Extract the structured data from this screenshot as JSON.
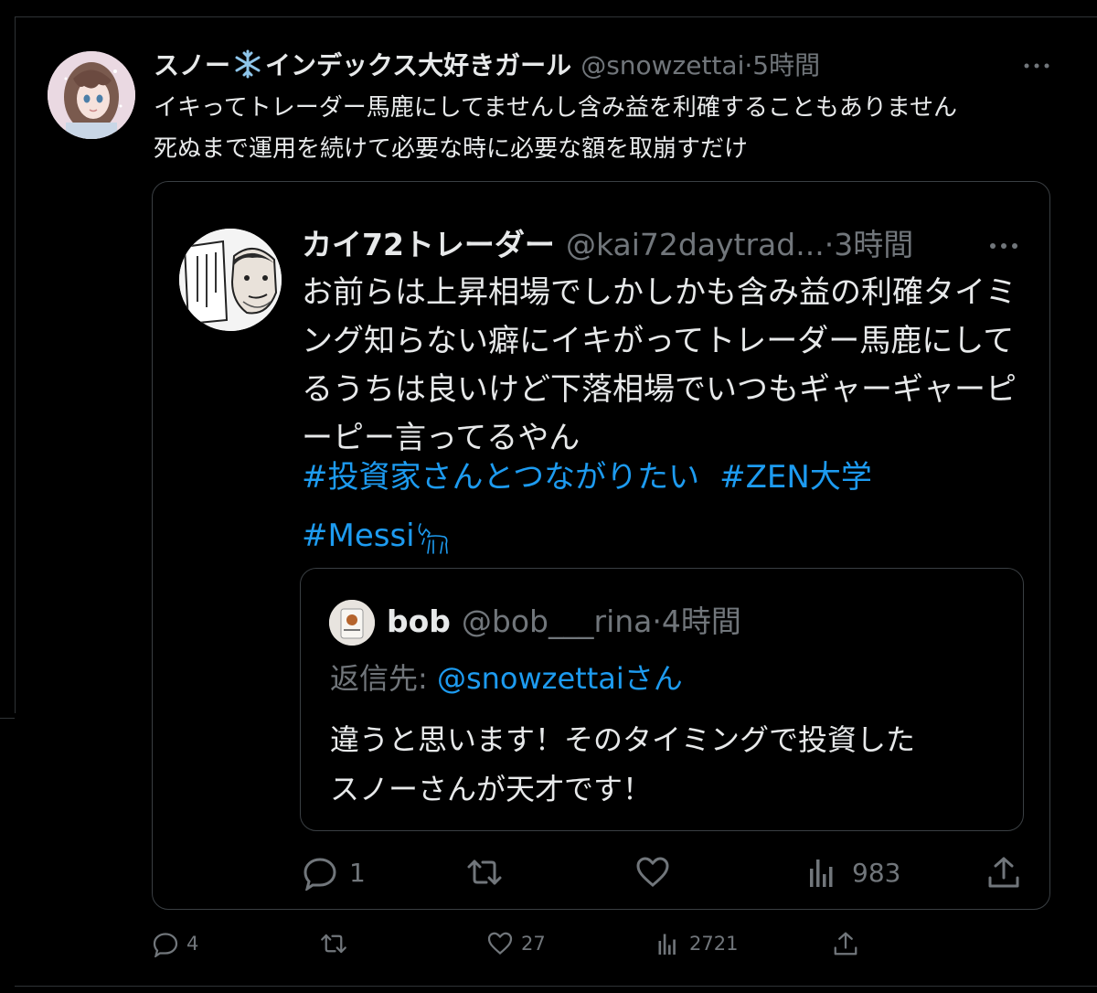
{
  "main_tweet": {
    "display_name_part1": "スノー",
    "display_name_part2": "インデックス大好きガール",
    "name_emoji": "snowflake-icon",
    "handle": "@snowzettai",
    "separator": "·",
    "time": "5時間",
    "text_line1": "イキってトレーダー馬鹿にしてませんし含み益を利確することもありません",
    "text_line2": "死ぬまで運用を続けて必要な時に必要な額を取崩すだけ",
    "actions": {
      "replies": "4",
      "retweets": "",
      "likes": "27",
      "views": "2721"
    }
  },
  "quoted_tweet": {
    "display_name": "カイ72トレーダー",
    "handle": "@kai72daytrad...",
    "separator": "·",
    "time": "3時間",
    "text": "お前らは上昇相場でしかしかも含み益の利確タイミング知らない癖にイキがってトレーダー馬鹿にしてるうちは良いけど下落相場でいつもギャーギャーピーピー言ってるやん",
    "hashtags": [
      "#投資家さんとつながりたい",
      "#ZEN大学",
      "#Messi"
    ],
    "hashtag_emoji": "goat-icon",
    "actions": {
      "replies": "1",
      "retweets": "",
      "likes": "",
      "views": "983"
    }
  },
  "nested_tweet": {
    "display_name": "bob",
    "handle": "@bob___rina",
    "separator": "·",
    "time": "4時間",
    "reply_prefix": "返信先: ",
    "reply_mention": "@snowzettai",
    "reply_suffix": "さん",
    "text_line1": "違うと思います！そのタイミングで投資した",
    "text_line2": "スノーさんが天才です！"
  },
  "colors": {
    "background": "#000000",
    "text": "#e7e9ea",
    "muted": "#71767b",
    "link": "#1d9bf0",
    "border": "#3a3f43"
  }
}
